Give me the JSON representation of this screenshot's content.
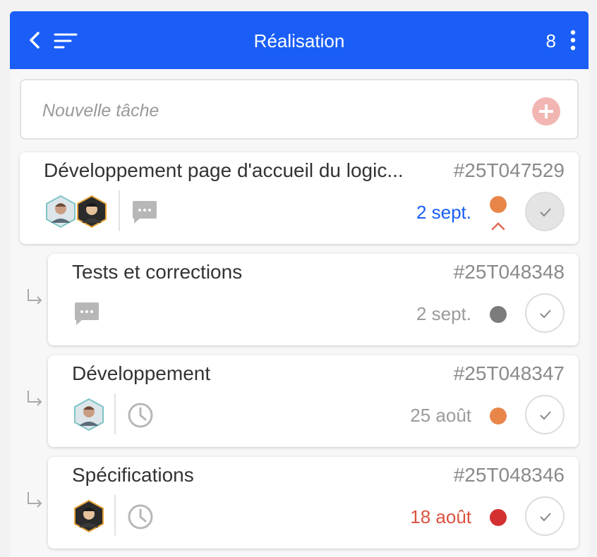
{
  "header": {
    "title": "Réalisation",
    "count": "8"
  },
  "new_task": {
    "placeholder": "Nouvelle tâche"
  },
  "colors": {
    "primary": "#1a5ef7",
    "orange": "#e8864a",
    "gray": "#7c7c7c",
    "red": "#d33131",
    "blue_date": "#1a5ef7",
    "red_date": "#d9533f"
  },
  "tasks": [
    {
      "name": "Développement page d'accueil du logic...",
      "ref": "#25T047529",
      "date": "2 sept.",
      "priority": "orange",
      "expanded": true,
      "completed": false,
      "icons": [
        "avatar-1",
        "avatar-2",
        "comment-icon"
      ]
    },
    {
      "name": "Tests et corrections",
      "ref": "#25T048348",
      "date": "2 sept.",
      "priority": "gray",
      "subtask": true,
      "icons": [
        "comment-icon"
      ]
    },
    {
      "name": "Développement",
      "ref": "#25T048347",
      "date": "25 août",
      "priority": "orange",
      "subtask": true,
      "icons": [
        "avatar-1",
        "clock-icon"
      ]
    },
    {
      "name": "Spécifications",
      "ref": "#25T048346",
      "date": "18 août",
      "priority": "red",
      "subtask": true,
      "icons": [
        "avatar-2",
        "clock-icon"
      ]
    }
  ]
}
